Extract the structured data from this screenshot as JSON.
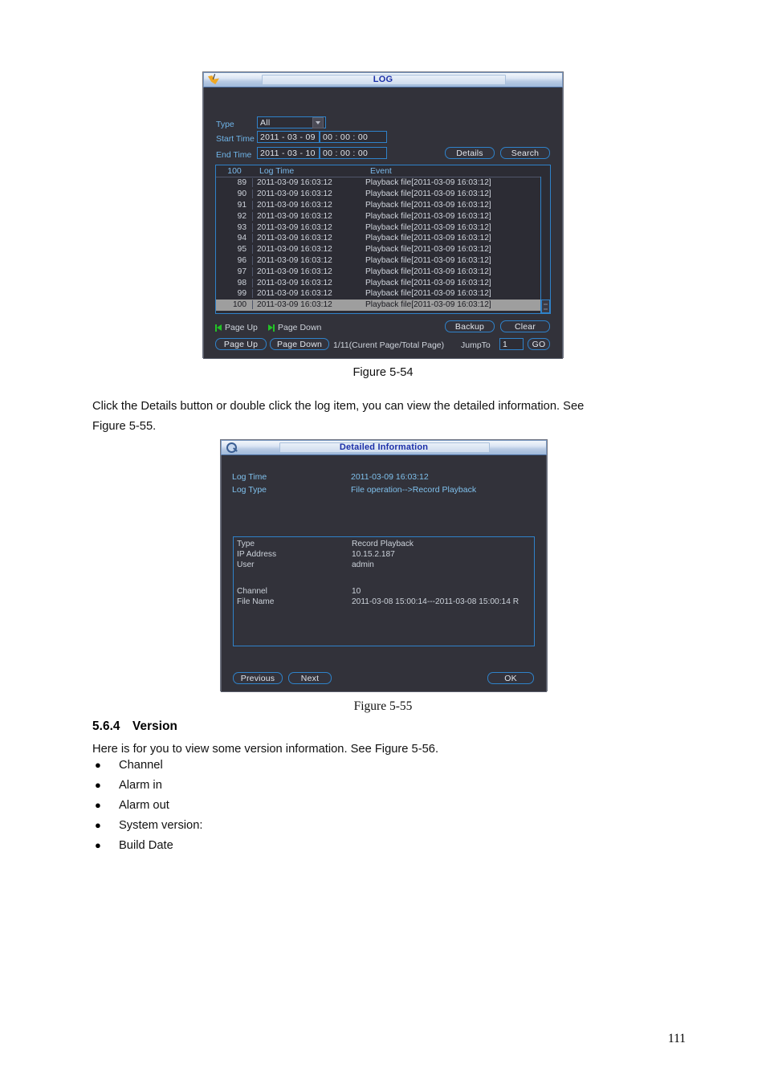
{
  "document": {
    "page_number": "111",
    "figure_54_caption": "Figure 5-54",
    "paragraph_1_line_1": "Click the Details button or double click the log item, you can view the detailed information. See",
    "paragraph_1_line_2": "Figure 5-55.",
    "figure_55_caption": "Figure 5-55",
    "section_number": "5.6.4",
    "section_title": "Version",
    "paragraph_2": "Here is for you to view some version information. See Figure 5-56.",
    "bullets": [
      "Channel",
      "Alarm in",
      "Alarm out",
      "System version:",
      "Build Date"
    ]
  },
  "log_dialog": {
    "title": "LOG",
    "titlebar_icon": "bird-icon",
    "type_label": "Type",
    "type_value": "All",
    "start_time_label": "Start Time",
    "start_date_value": "2011  - 03 - 09",
    "start_time_value": "00 : 00 : 00",
    "end_time_label": "End Time",
    "end_date_value": "2011  - 03 - 10",
    "end_time_value": "00 : 00 : 00",
    "details_button": "Details",
    "search_button": "Search",
    "table": {
      "headers": [
        "100",
        "Log Time",
        "Event"
      ],
      "rows": [
        {
          "no": "89",
          "log_time": "2011-03-09 16:03:12",
          "event": "Playback file[2011-03-09 16:03:12]",
          "selected": false
        },
        {
          "no": "90",
          "log_time": "2011-03-09 16:03:12",
          "event": "Playback file[2011-03-09 16:03:12]",
          "selected": false
        },
        {
          "no": "91",
          "log_time": "2011-03-09 16:03:12",
          "event": "Playback file[2011-03-09 16:03:12]",
          "selected": false
        },
        {
          "no": "92",
          "log_time": "2011-03-09 16:03:12",
          "event": "Playback file[2011-03-09 16:03:12]",
          "selected": false
        },
        {
          "no": "93",
          "log_time": "2011-03-09 16:03:12",
          "event": "Playback file[2011-03-09 16:03:12]",
          "selected": false
        },
        {
          "no": "94",
          "log_time": "2011-03-09 16:03:12",
          "event": "Playback file[2011-03-09 16:03:12]",
          "selected": false
        },
        {
          "no": "95",
          "log_time": "2011-03-09 16:03:12",
          "event": "Playback file[2011-03-09 16:03:12]",
          "selected": false
        },
        {
          "no": "96",
          "log_time": "2011-03-09 16:03:12",
          "event": "Playback file[2011-03-09 16:03:12]",
          "selected": false
        },
        {
          "no": "97",
          "log_time": "2011-03-09 16:03:12",
          "event": "Playback file[2011-03-09 16:03:12]",
          "selected": false
        },
        {
          "no": "98",
          "log_time": "2011-03-09 16:03:12",
          "event": "Playback file[2011-03-09 16:03:12]",
          "selected": false
        },
        {
          "no": "99",
          "log_time": "2011-03-09 16:03:12",
          "event": "Playback file[2011-03-09 16:03:12]",
          "selected": false
        },
        {
          "no": "100",
          "log_time": "2011-03-09 16:03:12",
          "event": "Playback file[2011-03-09 16:03:12]",
          "selected": true
        }
      ]
    },
    "nav_page_up_label": "Page Up",
    "nav_page_down_label": "Page Down",
    "page_up_button": "Page Up",
    "page_down_button": "Page Down",
    "page_info": "1/11(Curent Page/Total Page)",
    "backup_button": "Backup",
    "clear_button": "Clear",
    "jumpto_label": "JumpTo",
    "jumpto_value": "1",
    "go_button": "GO"
  },
  "detail_dialog": {
    "title": "Detailed Information",
    "titlebar_icon": "magnifier-icon",
    "log_time_label": "Log Time",
    "log_time_value": "2011-03-09 16:03:12",
    "log_type_label": "Log Type",
    "log_type_value": "File operation-->Record Playback",
    "panel": {
      "type_label": "Type",
      "type_value": "Record Playback",
      "ip_label": "IP Address",
      "ip_value": "10.15.2.187",
      "user_label": "User",
      "user_value": "admin",
      "channel_label": "Channel",
      "channel_value": "10",
      "filename_label": "File Name",
      "filename_value": "2011-03-08 15:00:14---2011-03-08 15:00:14 R"
    },
    "previous_button": "Previous",
    "next_button": "Next",
    "ok_button": "OK"
  },
  "colors": {
    "dialog_bg": "#32323a",
    "accent_blue": "#2f82c9",
    "label_blue": "#6fb4e8",
    "title_blue": "#1b2fa8",
    "nav_green": "#22c326",
    "selected_row": "#9e9e9e"
  }
}
